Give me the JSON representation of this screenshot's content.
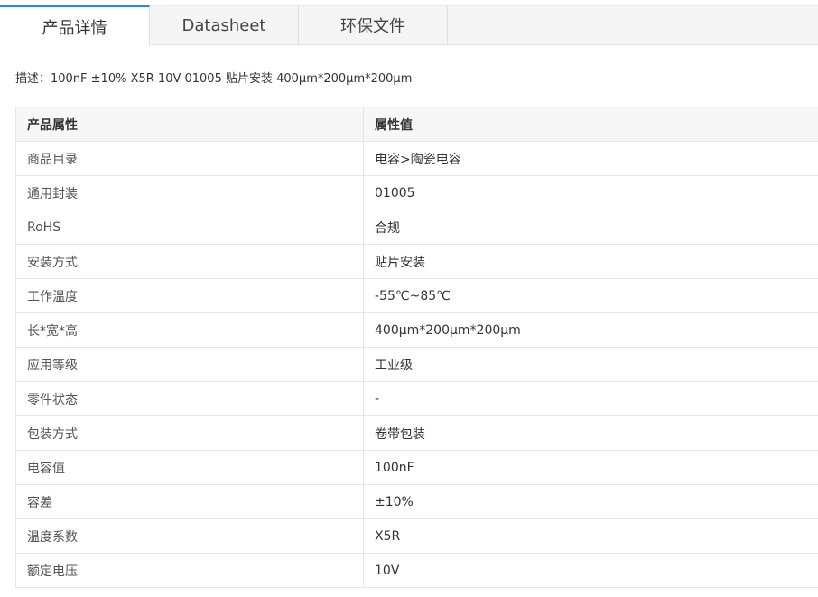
{
  "tabs": [
    "产品详情",
    "Datasheet",
    "环保文件"
  ],
  "description": "描述：100nF ±10% X5R 10V 01005 贴片安装 400μm*200μm*200μm",
  "table": {
    "headers": [
      "产品属性",
      "属性值"
    ],
    "rows": [
      [
        "商品目录",
        "电容>陶瓷电容"
      ],
      [
        "通用封装",
        "01005"
      ],
      [
        "RoHS",
        "合规"
      ],
      [
        "安装方式",
        "贴片安装"
      ],
      [
        "工作温度",
        "-55℃~85℃"
      ],
      [
        "长*宽*高",
        "400μm*200μm*200μm"
      ],
      [
        "应用等级",
        "工业级"
      ],
      [
        "零件状态",
        "-"
      ],
      [
        "包装方式",
        "卷带包装"
      ],
      [
        "电容值",
        "100nF"
      ],
      [
        "容差",
        "±10%"
      ],
      [
        "温度系数",
        "X5R"
      ],
      [
        "额定电压",
        "10V"
      ]
    ]
  },
  "colors": {
    "accent": "#1f8ed9"
  }
}
